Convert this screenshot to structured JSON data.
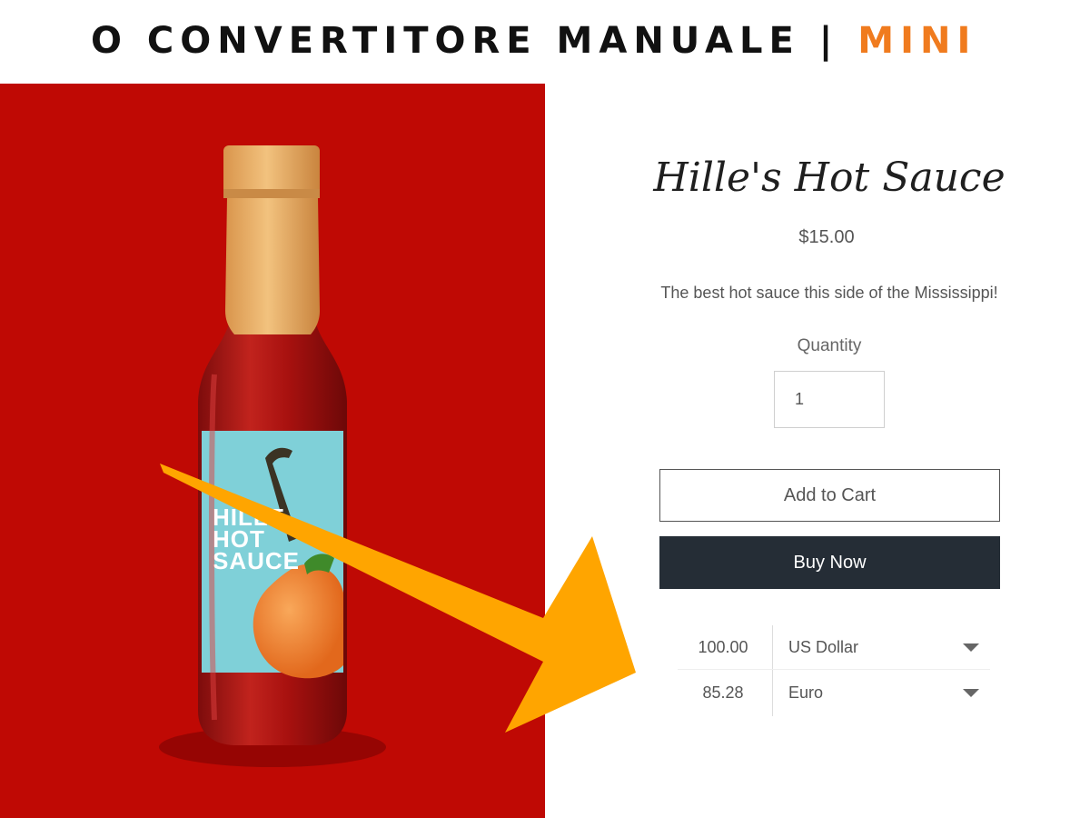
{
  "banner": {
    "title": "O CONVERTITORE MANUALE | ",
    "accent": "MINI",
    "accent_color": "#f07b1e"
  },
  "image_panel": {
    "background_color": "#bf0904",
    "label_lines": [
      "HILLE",
      "HOT",
      "SAUCE"
    ]
  },
  "product": {
    "title": "Hille's Hot Sauce",
    "price": "$15.00",
    "description": "The best hot sauce this side of the Mississippi!",
    "quantity_label": "Quantity",
    "quantity_value": "1",
    "add_to_cart_label": "Add to Cart",
    "buy_now_label": "Buy Now",
    "buy_now_color": "#252d36"
  },
  "converter": {
    "rows": [
      {
        "amount": "100.00",
        "currency": "US Dollar"
      },
      {
        "amount": "85.28",
        "currency": "Euro"
      }
    ]
  },
  "overlay": {
    "arrow_color": "#ffa500",
    "arrow_icon": "arrow-icon"
  }
}
